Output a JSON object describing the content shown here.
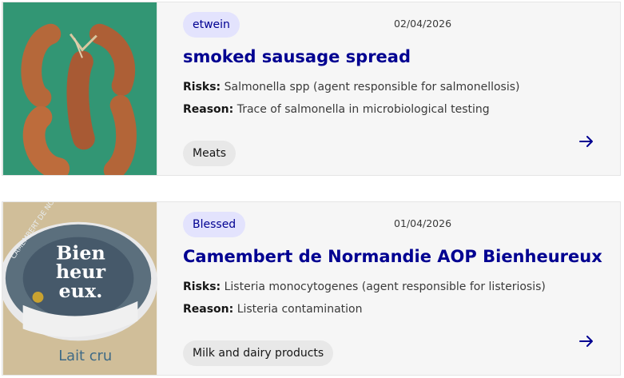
{
  "recalls": [
    {
      "brand": "etwein",
      "date": "02/04/2026",
      "title": "smoked sausage spread",
      "risks_label": "Risks:",
      "risks": "Salmonella spp (agent responsible for salmonellosis)",
      "reason_label": "Reason:",
      "reason": "Trace of salmonella in microbiological testing",
      "category": "Meats",
      "image_icon": "sausage-photo"
    },
    {
      "brand": "Blessed",
      "date": "01/04/2026",
      "title": "Camembert de Normandie AOP Bienheureux",
      "risks_label": "Risks:",
      "risks": "Listeria monocytogenes (agent responsible for listeriosis)",
      "reason_label": "Reason:",
      "reason": "Listeria contamination",
      "category": "Milk and dairy products",
      "image_icon": "cheese-box-photo",
      "image_text": {
        "brand_line1": "Bien",
        "brand_line2": "heur",
        "brand_line3": "eux.",
        "rim": "CAMEMBERT DE NORMANDIE",
        "bottom": "Lait cru"
      }
    }
  ],
  "colors": {
    "accent": "#000091",
    "brand_pill": "#e3e3fd",
    "tag_pill": "#e8e8e8",
    "card_bg": "#f6f6f6"
  },
  "arrow_icon": "arrow-right-icon"
}
